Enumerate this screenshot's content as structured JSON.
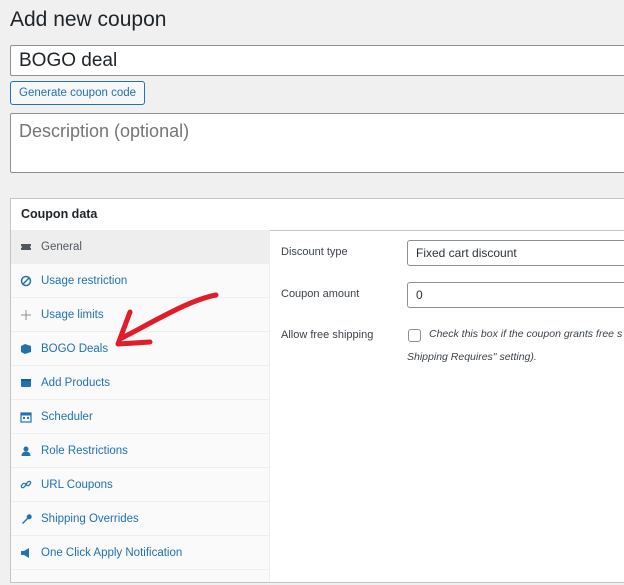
{
  "page": {
    "title": "Add new coupon"
  },
  "coupon": {
    "code_value": "BOGO deal",
    "generate_label": "Generate coupon code",
    "description_placeholder": "Description (optional)"
  },
  "panel": {
    "title": "Coupon data",
    "tabs": [
      {
        "label": "General",
        "icon": "ticket-icon"
      },
      {
        "label": "Usage restriction",
        "icon": "block-icon"
      },
      {
        "label": "Usage limits",
        "icon": "plus-icon"
      },
      {
        "label": "BOGO Deals",
        "icon": "tag-icon"
      },
      {
        "label": "Add Products",
        "icon": "box-icon"
      },
      {
        "label": "Scheduler",
        "icon": "calendar-icon"
      },
      {
        "label": "Role Restrictions",
        "icon": "user-icon"
      },
      {
        "label": "URL Coupons",
        "icon": "link-icon"
      },
      {
        "label": "Shipping Overrides",
        "icon": "wrench-icon"
      },
      {
        "label": "One Click Apply Notification",
        "icon": "megaphone-icon"
      }
    ],
    "fields": {
      "discount_type_label": "Discount type",
      "discount_type_value": "Fixed cart discount",
      "coupon_amount_label": "Coupon amount",
      "coupon_amount_value": "0",
      "free_shipping_label": "Allow free shipping",
      "free_shipping_desc_line1": "Check this box if the coupon grants free s",
      "free_shipping_desc_line2": "Shipping Requires\" setting)."
    }
  },
  "colors": {
    "accent": "#2271b1",
    "annotation": "#e11d2a"
  }
}
